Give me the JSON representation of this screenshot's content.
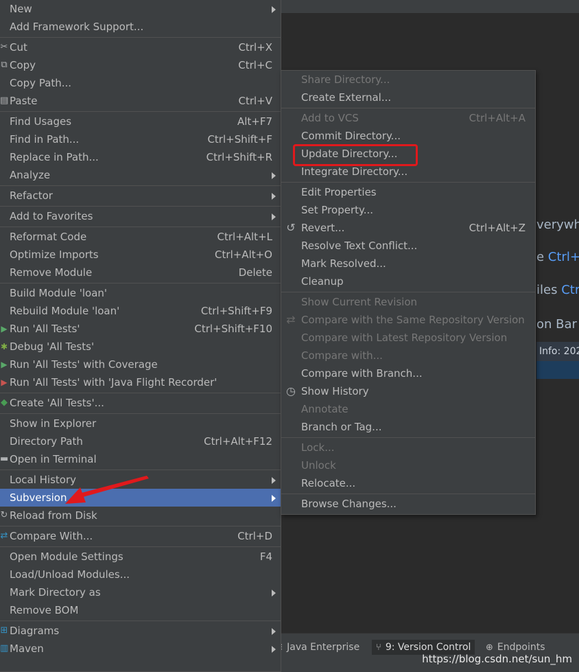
{
  "main_menu": {
    "items": [
      {
        "label": "New",
        "submenu": true
      },
      {
        "label": "Add Framework Support..."
      },
      {
        "sep": true
      },
      {
        "label": "Cut",
        "shortcut": "Ctrl+X",
        "icon": "scissors"
      },
      {
        "label": "Copy",
        "shortcut": "Ctrl+C",
        "icon": "copy"
      },
      {
        "label": "Copy Path..."
      },
      {
        "label": "Paste",
        "shortcut": "Ctrl+V",
        "icon": "paste"
      },
      {
        "sep": true
      },
      {
        "label": "Find Usages",
        "shortcut": "Alt+F7"
      },
      {
        "label": "Find in Path...",
        "shortcut": "Ctrl+Shift+F"
      },
      {
        "label": "Replace in Path...",
        "shortcut": "Ctrl+Shift+R"
      },
      {
        "label": "Analyze",
        "submenu": true
      },
      {
        "sep": true
      },
      {
        "label": "Refactor",
        "submenu": true
      },
      {
        "sep": true
      },
      {
        "label": "Add to Favorites",
        "submenu": true
      },
      {
        "sep": true
      },
      {
        "label": "Reformat Code",
        "shortcut": "Ctrl+Alt+L"
      },
      {
        "label": "Optimize Imports",
        "shortcut": "Ctrl+Alt+O"
      },
      {
        "label": "Remove Module",
        "shortcut": "Delete"
      },
      {
        "sep": true
      },
      {
        "label": "Build Module 'loan'"
      },
      {
        "label": "Rebuild Module 'loan'",
        "shortcut": "Ctrl+Shift+F9"
      },
      {
        "label": "Run 'All Tests'",
        "shortcut": "Ctrl+Shift+F10",
        "icon": "run"
      },
      {
        "label": "Debug 'All Tests'",
        "icon": "debug"
      },
      {
        "label": "Run 'All Tests' with Coverage",
        "icon": "coverage"
      },
      {
        "label": "Run 'All Tests' with 'Java Flight Recorder'",
        "icon": "flight-recorder"
      },
      {
        "sep": true
      },
      {
        "label": "Create 'All Tests'...",
        "icon": "create-test"
      },
      {
        "sep": true
      },
      {
        "label": "Show in Explorer"
      },
      {
        "label": "Directory Path",
        "shortcut": "Ctrl+Alt+F12"
      },
      {
        "label": "Open in Terminal",
        "icon": "terminal"
      },
      {
        "sep": true
      },
      {
        "label": "Local History",
        "submenu": true
      },
      {
        "label": "Subversion",
        "submenu": true,
        "selected": true
      },
      {
        "label": "Reload from Disk",
        "icon": "reload"
      },
      {
        "sep": true
      },
      {
        "label": "Compare With...",
        "shortcut": "Ctrl+D",
        "icon": "compare"
      },
      {
        "sep": true
      },
      {
        "label": "Open Module Settings",
        "shortcut": "F4"
      },
      {
        "label": "Load/Unload Modules..."
      },
      {
        "label": "Mark Directory as",
        "submenu": true
      },
      {
        "label": "Remove BOM"
      },
      {
        "sep": true
      },
      {
        "label": "Diagrams",
        "submenu": true,
        "icon": "diagram"
      },
      {
        "label": "Maven",
        "submenu": true,
        "icon": "maven"
      }
    ]
  },
  "sub_menu": {
    "items": [
      {
        "label": "Share Directory...",
        "disabled": true
      },
      {
        "label": "Create External..."
      },
      {
        "sep": true
      },
      {
        "label": "Add to VCS",
        "shortcut": "Ctrl+Alt+A",
        "disabled": true
      },
      {
        "label": "Commit Directory..."
      },
      {
        "label": "Update Directory..."
      },
      {
        "label": "Integrate Directory..."
      },
      {
        "sep": true
      },
      {
        "label": "Edit Properties"
      },
      {
        "label": "Set Property..."
      },
      {
        "label": "Revert...",
        "shortcut": "Ctrl+Alt+Z",
        "icon": "revert"
      },
      {
        "label": "Resolve Text Conflict..."
      },
      {
        "label": "Mark Resolved..."
      },
      {
        "label": "Cleanup"
      },
      {
        "sep": true
      },
      {
        "label": "Show Current Revision",
        "disabled": true
      },
      {
        "label": "Compare with the Same Repository Version",
        "disabled": true,
        "icon": "compare"
      },
      {
        "label": "Compare with Latest Repository Version",
        "disabled": true
      },
      {
        "label": "Compare with...",
        "disabled": true
      },
      {
        "label": "Compare with Branch..."
      },
      {
        "label": "Show History",
        "icon": "clock"
      },
      {
        "label": "Annotate",
        "disabled": true
      },
      {
        "label": "Branch or Tag..."
      },
      {
        "sep": true
      },
      {
        "label": "Lock...",
        "disabled": true
      },
      {
        "label": "Unlock",
        "disabled": true
      },
      {
        "label": "Relocate..."
      },
      {
        "sep": true
      },
      {
        "label": "Browse Changes..."
      }
    ]
  },
  "editor_hints": [
    {
      "text": "verywh",
      "key": ""
    },
    {
      "text": "e ",
      "key": "Ctrl+"
    },
    {
      "text": "iles ",
      "key": "Ctr"
    },
    {
      "text": "on Bar",
      "key": ""
    }
  ],
  "info_bar": "Info: 202",
  "tool_window_bar": [
    {
      "label": "Java Enterprise",
      "icon": "java-enterprise"
    },
    {
      "label": "9: Version Control",
      "icon": "version-control",
      "active": true
    },
    {
      "label": "Endpoints",
      "icon": "globe"
    }
  ],
  "watermark": "https://blog.csdn.net/sun_hm",
  "colors": {
    "menu_bg": "#3c3f41",
    "selected_bg": "#4b6eaf",
    "annotation_red": "#e0191c"
  }
}
